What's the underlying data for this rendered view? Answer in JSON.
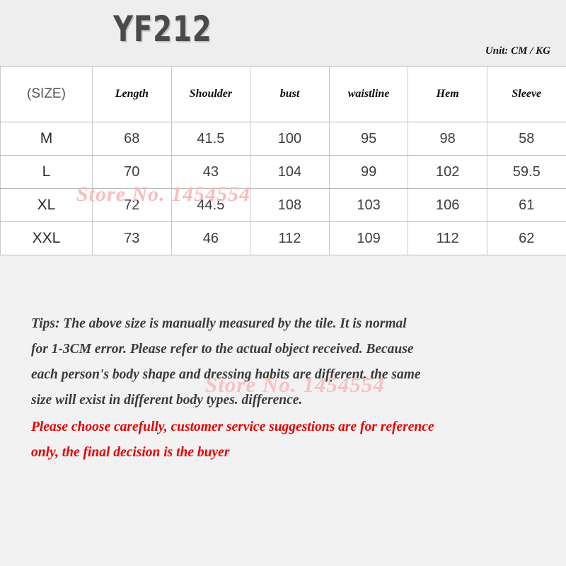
{
  "header": {
    "product_code": "YF212",
    "unit_label": "Unit: CM / KG"
  },
  "table": {
    "columns": [
      "(SIZE)",
      "Length",
      "Shoulder",
      "bust",
      "waistline",
      "Hem",
      "Sleeve"
    ],
    "rows": [
      {
        "size": "M",
        "length": "68",
        "shoulder": "41.5",
        "bust": "100",
        "waistline": "95",
        "hem": "98",
        "sleeve": "58"
      },
      {
        "size": "L",
        "length": "70",
        "shoulder": "43",
        "bust": "104",
        "waistline": "99",
        "hem": "102",
        "sleeve": "59.5"
      },
      {
        "size": "XL",
        "length": "72",
        "shoulder": "44.5",
        "bust": "108",
        "waistline": "103",
        "hem": "106",
        "sleeve": "61"
      },
      {
        "size": "XXL",
        "length": "73",
        "shoulder": "46",
        "bust": "112",
        "waistline": "109",
        "hem": "112",
        "sleeve": "62"
      }
    ]
  },
  "watermark": {
    "text": "Store No. 1454554"
  },
  "tips": {
    "lines": [
      "Tips: The above size is manually measured by the tile. It is normal",
      "for 1-3CM error. Please refer to the actual object received. Because",
      "each person's body shape and dressing habits are different, the same",
      "size will exist in different body types. difference."
    ],
    "warning_lines": [
      "Please choose carefully, customer service suggestions are for reference",
      "only, the final decision is the buyer"
    ]
  },
  "colors": {
    "page_background": "#f2f2f2",
    "header_background": "#eeeeee",
    "table_background": "#ffffff",
    "title_color": "#4a4a4a",
    "body_text": "#3a3a3a",
    "warning_text": "#e60000",
    "watermark_pink": "#f7bdbd",
    "border_gray": "#b9b9b9"
  }
}
